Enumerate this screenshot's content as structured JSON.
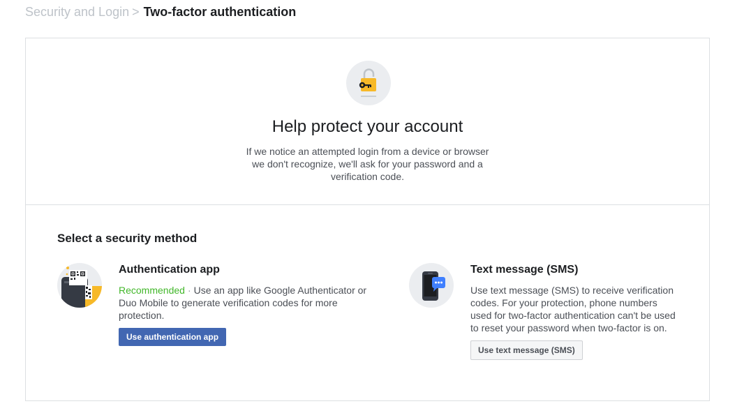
{
  "breadcrumb": {
    "parent": "Security and Login",
    "separator": ">",
    "current": "Two-factor authentication"
  },
  "hero": {
    "icon": "padlock-key-icon",
    "title": "Help protect your account",
    "description": "If we notice an attempted login from a device or browser we don't recognize, we'll ask for your password and a verification code."
  },
  "section": {
    "title": "Select a security method"
  },
  "methods": [
    {
      "icon": "authenticator-phone-qr-icon",
      "title": "Authentication app",
      "recommended": "Recommended",
      "separator": "·",
      "description": "Use an app like Google Authenticator or Duo Mobile to generate verification codes for more protection.",
      "button": "Use authentication app"
    },
    {
      "icon": "phone-sms-icon",
      "title": "Text message (SMS)",
      "description": "Use text message (SMS) to receive verification codes. For your protection, phone numbers used for two-factor authentication can't be used to reset your password when two-factor is on.",
      "button": "Use text message (SMS)"
    }
  ],
  "colors": {
    "primary_button": "#4267b2",
    "recommended": "#42b72a",
    "lock": "#f7b928"
  }
}
